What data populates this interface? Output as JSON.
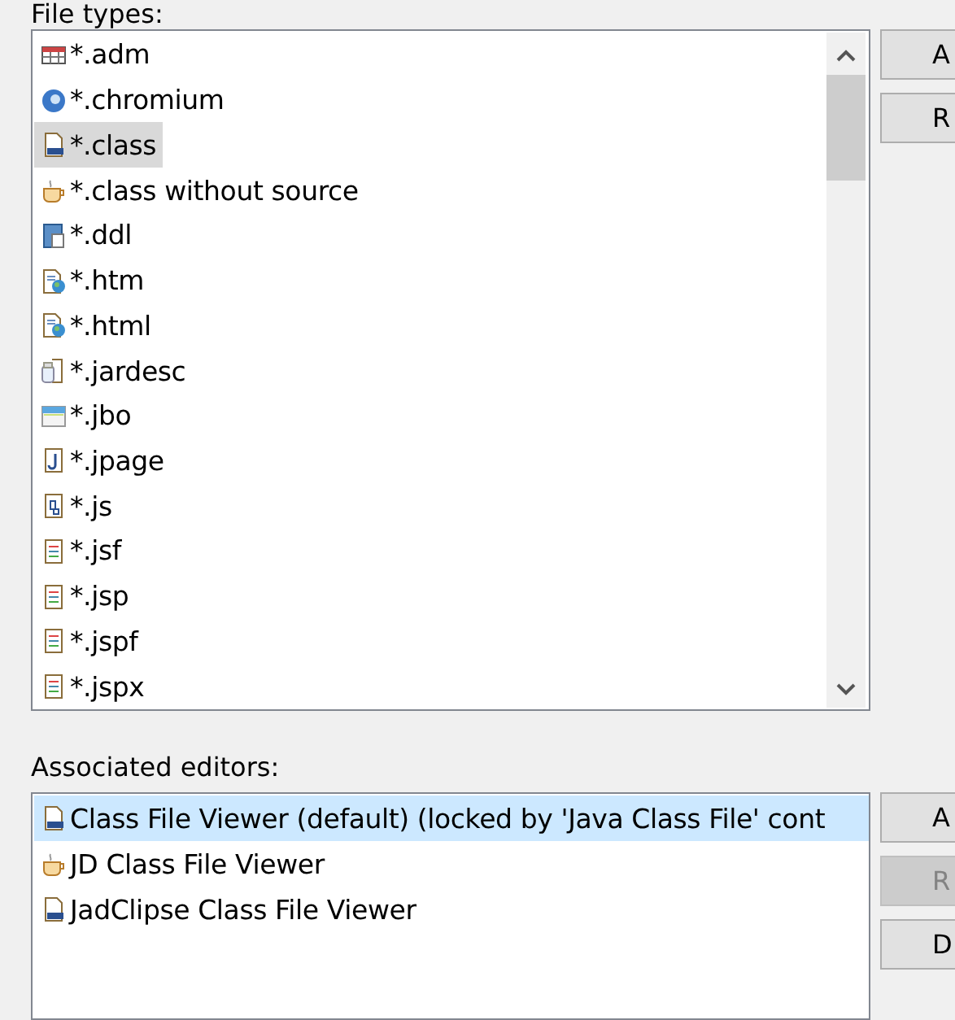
{
  "file_types": {
    "label": "File types:",
    "items": [
      {
        "kind": "table",
        "label": "*.adm",
        "selected": false
      },
      {
        "kind": "globe",
        "label": "*.chromium",
        "selected": false
      },
      {
        "kind": "class",
        "label": "*.class",
        "selected": true
      },
      {
        "kind": "cup",
        "label": "*.class without source",
        "selected": false
      },
      {
        "kind": "ddl",
        "label": "*.ddl",
        "selected": false
      },
      {
        "kind": "web",
        "label": "*.htm",
        "selected": false
      },
      {
        "kind": "web",
        "label": "*.html",
        "selected": false
      },
      {
        "kind": "jar",
        "label": "*.jardesc",
        "selected": false
      },
      {
        "kind": "window",
        "label": "*.jbo",
        "selected": false
      },
      {
        "kind": "jpage",
        "label": "*.jpage",
        "selected": false
      },
      {
        "kind": "script",
        "label": "*.js",
        "selected": false
      },
      {
        "kind": "text",
        "label": "*.jsf",
        "selected": false
      },
      {
        "kind": "text",
        "label": "*.jsp",
        "selected": false
      },
      {
        "kind": "text",
        "label": "*.jspf",
        "selected": false
      },
      {
        "kind": "text",
        "label": "*.jspx",
        "selected": false
      }
    ],
    "buttons": [
      {
        "label": "A",
        "disabled": false
      },
      {
        "label": "R",
        "disabled": false
      }
    ]
  },
  "editors": {
    "label": "Associated editors:",
    "items": [
      {
        "kind": "class",
        "label": "Class File Viewer (default) (locked by 'Java Class File' cont",
        "selected": true
      },
      {
        "kind": "cup",
        "label": "JD Class File Viewer",
        "selected": false
      },
      {
        "kind": "class",
        "label": "JadClipse Class File Viewer",
        "selected": false
      }
    ],
    "buttons": [
      {
        "label": "A",
        "disabled": false
      },
      {
        "label": "R",
        "disabled": true
      },
      {
        "label": "D",
        "disabled": false
      }
    ]
  }
}
